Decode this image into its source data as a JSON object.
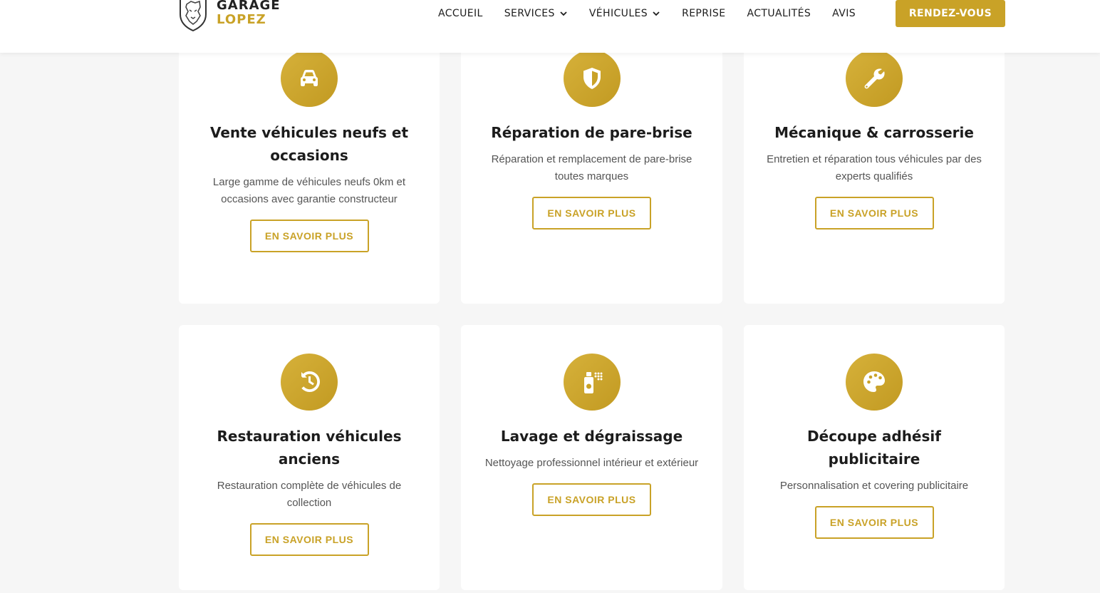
{
  "brand": {
    "line1": "GARAGE",
    "line2": "LOPEZ"
  },
  "nav": [
    {
      "label": "ACCUEIL",
      "dropdown": false
    },
    {
      "label": "SERVICES",
      "dropdown": true
    },
    {
      "label": "VÉHICULES",
      "dropdown": true
    },
    {
      "label": "REPRISE",
      "dropdown": false
    },
    {
      "label": "ACTUALITÉS",
      "dropdown": false
    },
    {
      "label": "AVIS",
      "dropdown": false
    }
  ],
  "cta": "RENDEZ-VOUS",
  "colors": {
    "accent": "#c9a227",
    "background": "#f6f6f6",
    "card": "#ffffff",
    "text": "#1c1c1c"
  },
  "services": [
    {
      "icon": "car-icon",
      "title": "Vente véhicules neufs et occasions",
      "desc": "Large gamme de véhicules neufs 0km et occasions avec garantie constructeur",
      "button": "EN SAVOIR PLUS"
    },
    {
      "icon": "shield-icon",
      "title": "Réparation de pare-brise",
      "desc": "Réparation et remplacement de pare-brise toutes marques",
      "button": "EN SAVOIR PLUS"
    },
    {
      "icon": "wrench-icon",
      "title": "Mécanique & carrosserie",
      "desc": "Entretien et réparation tous véhicules par des experts qualifiés",
      "button": "EN SAVOIR PLUS"
    },
    {
      "icon": "history-icon",
      "title": "Restauration véhicules anciens",
      "desc": "Restauration complète de véhicules de collection",
      "button": "EN SAVOIR PLUS"
    },
    {
      "icon": "spray-bottle-icon",
      "title": "Lavage et dégraissage",
      "desc": "Nettoyage professionnel intérieur et extérieur",
      "button": "EN SAVOIR PLUS"
    },
    {
      "icon": "palette-icon",
      "title": "Découpe adhésif publicitaire",
      "desc": "Personnalisation et covering publicitaire",
      "button": "EN SAVOIR PLUS"
    }
  ]
}
